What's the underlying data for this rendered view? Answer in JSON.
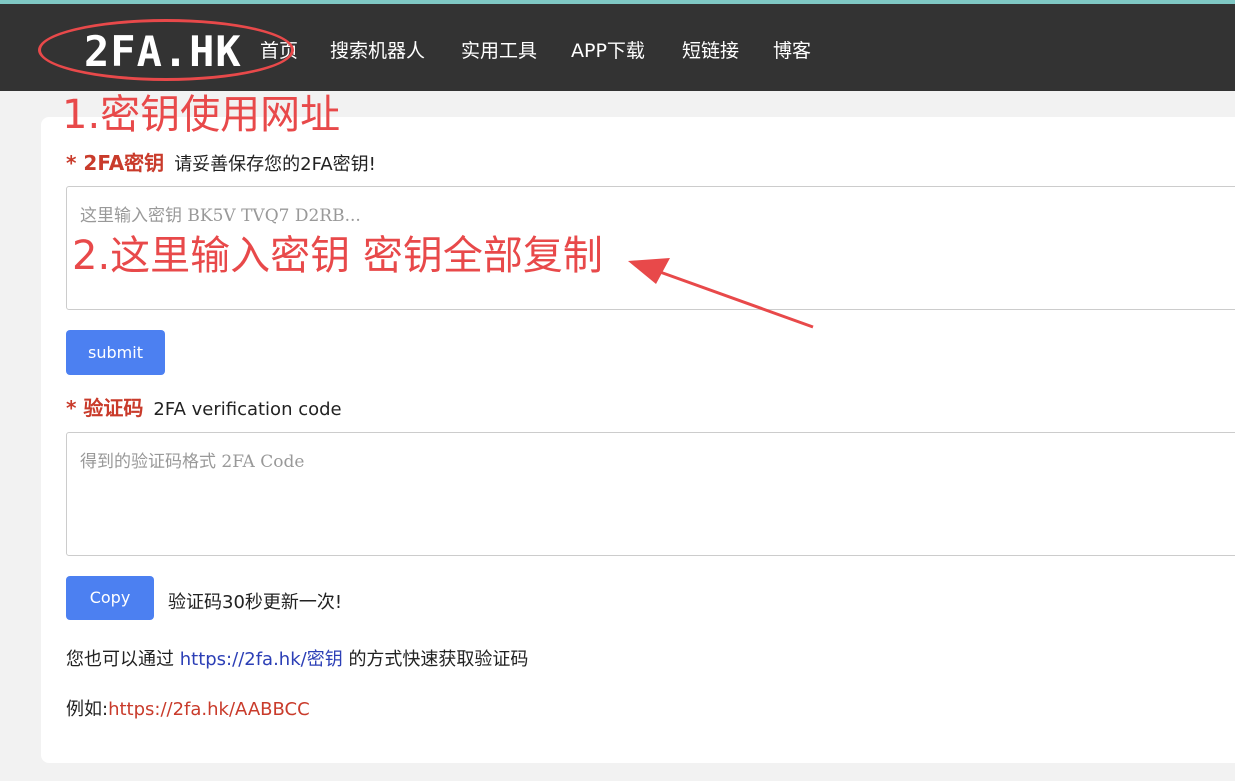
{
  "header": {
    "logo": "2FA.HK",
    "nav": [
      "首页",
      "搜索机器人",
      "实用工具",
      "APP下载",
      "短链接",
      "博客"
    ]
  },
  "annotations": {
    "step1": "1.密钥使用网址",
    "step2": "2.这里输入密钥 密钥全部复制"
  },
  "form": {
    "secret_required": "* 2FA密钥",
    "secret_hint": "请妥善保存您的2FA密钥!",
    "secret_placeholder": "这里输入密钥 BK5V TVQ7 D2RB...",
    "submit_label": "submit",
    "code_required": "* 验证码",
    "code_hint": "2FA verification code",
    "code_placeholder": "得到的验证码格式 2FA Code",
    "copy_label": "Copy",
    "refresh_note": "验证码30秒更新一次!",
    "url_prefix": "您也可以通过",
    "url_link": "https://2fa.hk/密钥",
    "url_suffix": "的方式快速获取验证码",
    "example_label": "例如:",
    "example_link": "https://2fa.hk/AABBCC"
  },
  "colors": {
    "navbar": "#333333",
    "accent_button": "#4c80f1",
    "annotation_red": "#e8494a",
    "required_red": "#c93b2b",
    "link_blue": "#2c3fb6"
  }
}
